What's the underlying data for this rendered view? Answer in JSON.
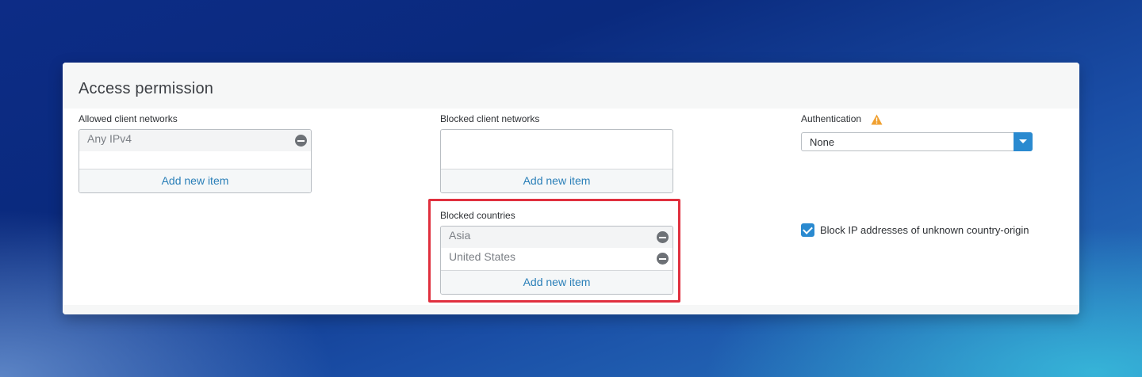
{
  "panel": {
    "title": "Access permission"
  },
  "allowed_networks": {
    "label": "Allowed client networks",
    "items": [
      {
        "label": "Any IPv4"
      }
    ],
    "add_label": "Add new item"
  },
  "blocked_networks": {
    "label": "Blocked client networks",
    "items": [],
    "add_label": "Add new item"
  },
  "blocked_countries": {
    "label": "Blocked countries",
    "items": [
      {
        "label": "Asia"
      },
      {
        "label": "United States"
      }
    ],
    "add_label": "Add new item",
    "highlighted": true
  },
  "authentication": {
    "label": "Authentication",
    "selected": "None",
    "warning_icon": "warning-triangle-icon"
  },
  "block_unknown_origin": {
    "label": "Block IP addresses of unknown country-origin",
    "checked": true
  },
  "colors": {
    "accent": "#2a8ad0",
    "link": "#2a7fb8",
    "highlight_border": "#e0303e",
    "warning": "#f0a030"
  }
}
